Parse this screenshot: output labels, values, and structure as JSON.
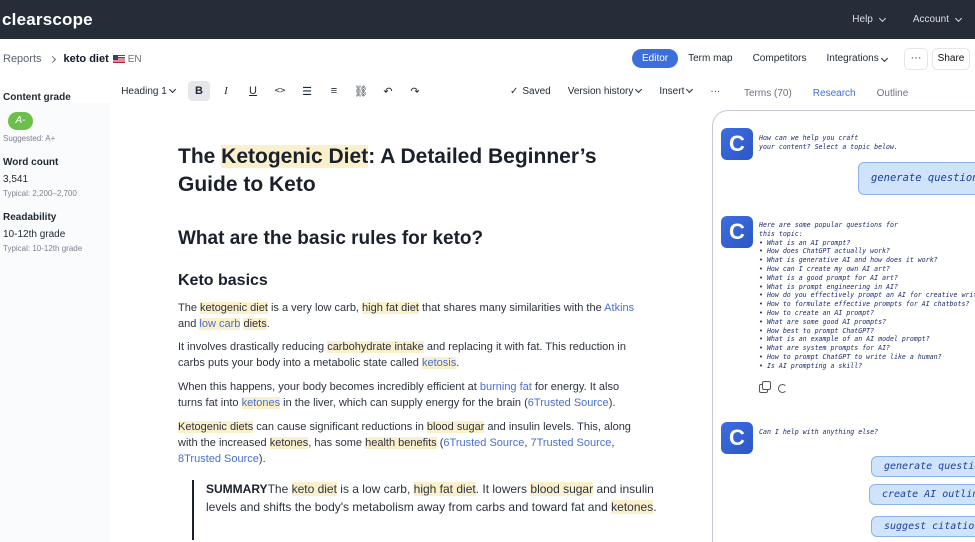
{
  "app": {
    "logo": "clearscope"
  },
  "topnav": {
    "help": "Help",
    "account": "Account"
  },
  "breadcrumb": {
    "reports": "Reports",
    "doc_name": "keto diet",
    "lang": "EN"
  },
  "view_tabs": [
    {
      "label": "Editor",
      "active": true
    },
    {
      "label": "Term map",
      "active": false
    },
    {
      "label": "Competitors",
      "active": false
    },
    {
      "label": "Integrations",
      "active": false
    }
  ],
  "actions": {
    "more": "···",
    "share": "Share"
  },
  "metrics": {
    "content_grade_label": "Content grade",
    "grade": "A-",
    "suggested": "Suggested: A+",
    "word_count_label": "Word count",
    "word_count": "3,541",
    "word_typical": "Typical: 2,200–2,700",
    "readability_label": "Readability",
    "readability": "10-12th grade",
    "readability_typical": "Typical: 10-12th grade"
  },
  "toolbar": {
    "heading": "Heading 1",
    "saved": "Saved",
    "version_history": "Version history",
    "insert": "Insert",
    "more": "···"
  },
  "article": {
    "title_pre": "The ",
    "title_hl": "Ketogenic Diet",
    "title_post": ": A Detailed Beginner’s Guide to Keto",
    "h2": "What are the basic rules for keto?",
    "h3": "Keto basics",
    "p1": {
      "a": "The ",
      "b": "ketogenic diet",
      "c": " is a very low carb, ",
      "d": "high fat diet",
      "e": " that shares many similarities with the ",
      "f": "Atkins",
      "g": " and ",
      "h": "low carb",
      "i": " ",
      "j": "diets",
      "k": "."
    },
    "p2": {
      "a": "It involves drastically reducing ",
      "b": "carbohydrate intake",
      "c": " and replacing it with fat. This reduction in carbs puts your body into a metabolic state called ",
      "d": "ketosis",
      "e": "."
    },
    "p3": {
      "a": "When this happens, your body becomes incredibly efficient at ",
      "b": "burning fat",
      "c": " for energy. It also turns fat into ",
      "d": "ketones",
      "e": " in the liver, which can supply energy for the brain (",
      "f": "6Trusted Source",
      "g": ")."
    },
    "p4": {
      "a": "Ketogenic diets",
      "b": " can cause significant reductions in ",
      "c": "blood sugar",
      "d": " and insulin levels. This, along with the increased ",
      "e": "ketones",
      "f": ", has some ",
      "g": "health benefits",
      "h": " (",
      "i": "6Trusted Source",
      "j": ", ",
      "k": "7Trusted Source",
      "l": ", ",
      "m": "8Trusted Source",
      "n": ")."
    },
    "summary": {
      "label": "SUMMARY",
      "a": "The ",
      "b": "keto diet",
      "c": " is a low carb, ",
      "d": "high fat diet",
      "e": ". It lowers ",
      "f": "blood sugar",
      "g": " and insulin levels and shifts the body's metabolism away from carbs and toward fat and ",
      "h": "ketones",
      "i": "."
    }
  },
  "right_tabs": [
    {
      "label": "Terms (70)",
      "active": false
    },
    {
      "label": "Research",
      "active": true
    },
    {
      "label": "Outline",
      "active": false
    }
  ],
  "chat": {
    "avatar_letter": "C",
    "msg1": [
      "How can we help you craft",
      "your content? Select a topic below."
    ],
    "pill1": "generate questions",
    "msg2_intro": [
      "Here are some popular questions for",
      "this topic:"
    ],
    "questions": [
      "• What is an AI prompt?",
      "• How does ChatGPT actually work?",
      "• What is generative AI and how does it work?",
      "• How can I create my own AI art?",
      "• What is a good prompt for AI art?",
      "• What is prompt engineering in AI?",
      "• How do you effectively prompt an AI for creative writing?",
      "• How to formulate effective prompts for AI chatbots?",
      "• How to create an AI prompt?",
      "• What are some good AI prompts?",
      "• How best to prompt ChatGPT?",
      "• What is an example of an AI model prompt?",
      "• What are system prompts for AI?",
      "• How to prompt ChatGPT to write like a human?",
      "• Is AI prompting a skill?"
    ],
    "msg3": "Can I help with anything else?",
    "pills": [
      "generate questions",
      "create AI outline",
      "suggest citations"
    ]
  }
}
